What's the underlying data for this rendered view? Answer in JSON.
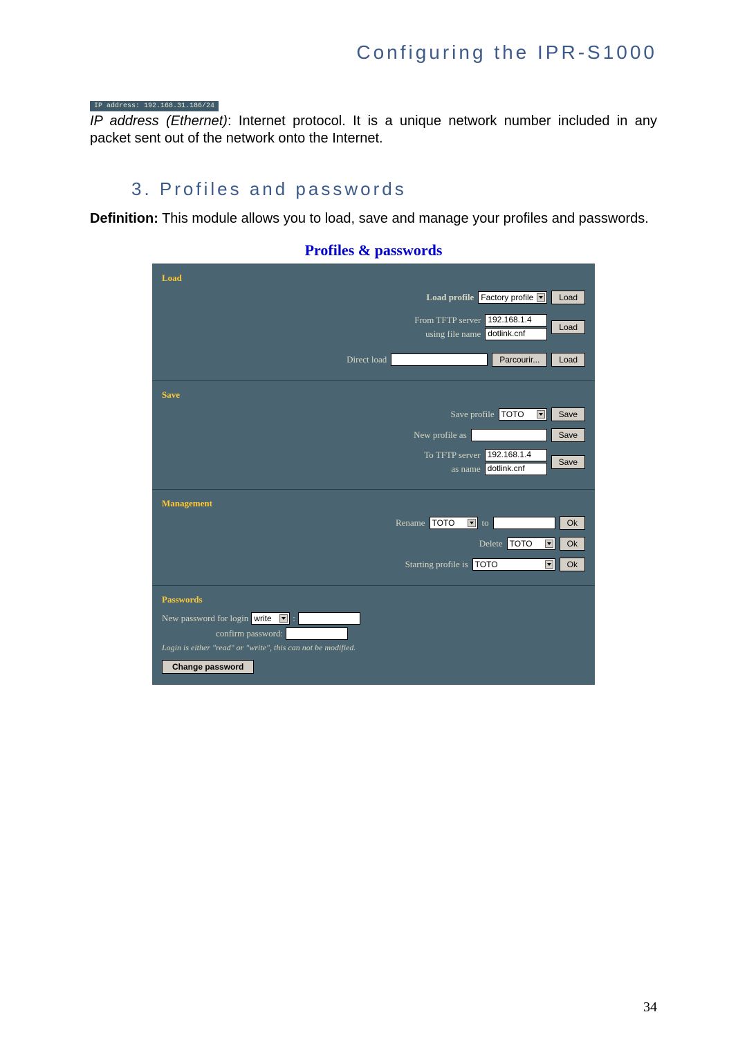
{
  "header": "Configuring the IPR-S1000",
  "ip_snippet": "IP address: 192.168.31.186/24",
  "ip_para_prefix": "IP address (Ethernet)",
  "ip_para_rest": ": Internet protocol. It is a unique network number included in any packet sent out of the network onto the Internet.",
  "section_heading": "3. Profiles and passwords",
  "definition_label": "Definition:",
  "definition_text": " This module allows you to load, save and manage your profiles and passwords.",
  "embed_title": "Profiles & passwords",
  "load": {
    "head": "Load",
    "load_profile_lbl": "Load profile",
    "load_profile_val": "Factory profile",
    "load_btn": "Load",
    "tftp_lbl": "From TFTP server",
    "tftp_val": "192.168.1.4",
    "filename_lbl": "using file name",
    "filename_val": "dotlink.cnf",
    "direct_lbl": "Direct load",
    "browse_btn": "Parcourir..."
  },
  "save": {
    "head": "Save",
    "save_profile_lbl": "Save profile",
    "save_profile_val": "TOTO",
    "save_btn": "Save",
    "new_profile_lbl": "New profile as",
    "tftp_lbl": "To TFTP server",
    "tftp_val": "192.168.1.4",
    "asname_lbl": "as name",
    "asname_val": "dotlink.cnf"
  },
  "mgmt": {
    "head": "Management",
    "rename_lbl": "Rename",
    "rename_val": "TOTO",
    "to_lbl": "to",
    "ok_btn": "Ok",
    "delete_lbl": "Delete",
    "delete_val": "TOTO",
    "start_lbl": "Starting profile is",
    "start_val": "TOTO"
  },
  "pw": {
    "head": "Passwords",
    "new_pw_lbl": "New password for login",
    "login_val": "write",
    "confirm_lbl": "confirm password:",
    "note": "Login is either \"read\" or \"write\", this can not be modified.",
    "change_btn": "Change password"
  },
  "page_num": "34"
}
